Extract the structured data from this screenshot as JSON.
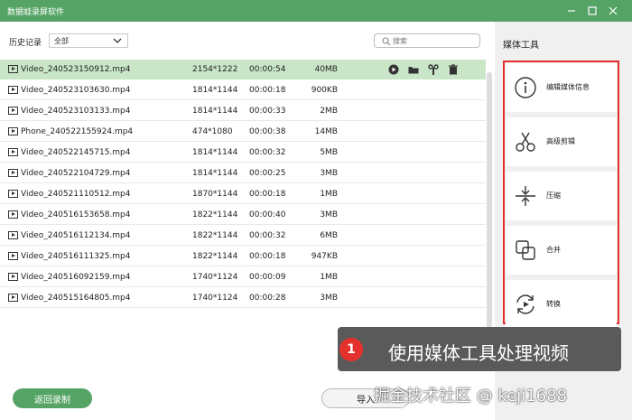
{
  "window": {
    "title": "数据蛙录屏软件"
  },
  "toolbar": {
    "history_label": "历史记录",
    "filter_value": "全部",
    "search_placeholder": "搜索"
  },
  "files": [
    {
      "name": "Video_240523150912.mp4",
      "resolution": "2154*1222",
      "duration": "00:00:54",
      "size": "40MB",
      "selected": true
    },
    {
      "name": "Video_240523103630.mp4",
      "resolution": "1814*1144",
      "duration": "00:00:18",
      "size": "900KB"
    },
    {
      "name": "Video_240523103133.mp4",
      "resolution": "1814*1144",
      "duration": "00:00:33",
      "size": "2MB"
    },
    {
      "name": "Phone_240522155924.mp4",
      "resolution": "474*1080",
      "duration": "00:00:38",
      "size": "14MB"
    },
    {
      "name": "Video_240522145715.mp4",
      "resolution": "1814*1144",
      "duration": "00:00:32",
      "size": "5MB"
    },
    {
      "name": "Video_240522104729.mp4",
      "resolution": "1814*1144",
      "duration": "00:00:25",
      "size": "3MB"
    },
    {
      "name": "Video_240521110512.mp4",
      "resolution": "1870*1144",
      "duration": "00:00:18",
      "size": "1MB"
    },
    {
      "name": "Video_240516153658.mp4",
      "resolution": "1822*1144",
      "duration": "00:00:40",
      "size": "3MB"
    },
    {
      "name": "Video_240516112134.mp4",
      "resolution": "1822*1144",
      "duration": "00:00:32",
      "size": "6MB"
    },
    {
      "name": "Video_240516111325.mp4",
      "resolution": "1822*1144",
      "duration": "00:00:18",
      "size": "947KB"
    },
    {
      "name": "Video_240516092159.mp4",
      "resolution": "1740*1124",
      "duration": "00:00:09",
      "size": "1MB"
    },
    {
      "name": "Video_240515164805.mp4",
      "resolution": "1740*1124",
      "duration": "00:00:28",
      "size": "3MB"
    }
  ],
  "footer": {
    "back_label": "返回录制",
    "import_label": "导入"
  },
  "sidebar": {
    "title": "媒体工具",
    "tools": [
      {
        "label": "编辑媒体信息",
        "icon": "info-icon"
      },
      {
        "label": "高级剪辑",
        "icon": "scissors-icon"
      },
      {
        "label": "压缩",
        "icon": "compress-icon"
      },
      {
        "label": "合并",
        "icon": "merge-icon"
      },
      {
        "label": "转换",
        "icon": "convert-icon"
      }
    ]
  },
  "callout": {
    "number": "1",
    "text": "使用媒体工具处理视频"
  },
  "watermark": "掘金技术社区 @ keji1688",
  "colors": {
    "accent": "#55a465",
    "selected_row": "#c9e6c8",
    "highlight": "#e5312e"
  }
}
